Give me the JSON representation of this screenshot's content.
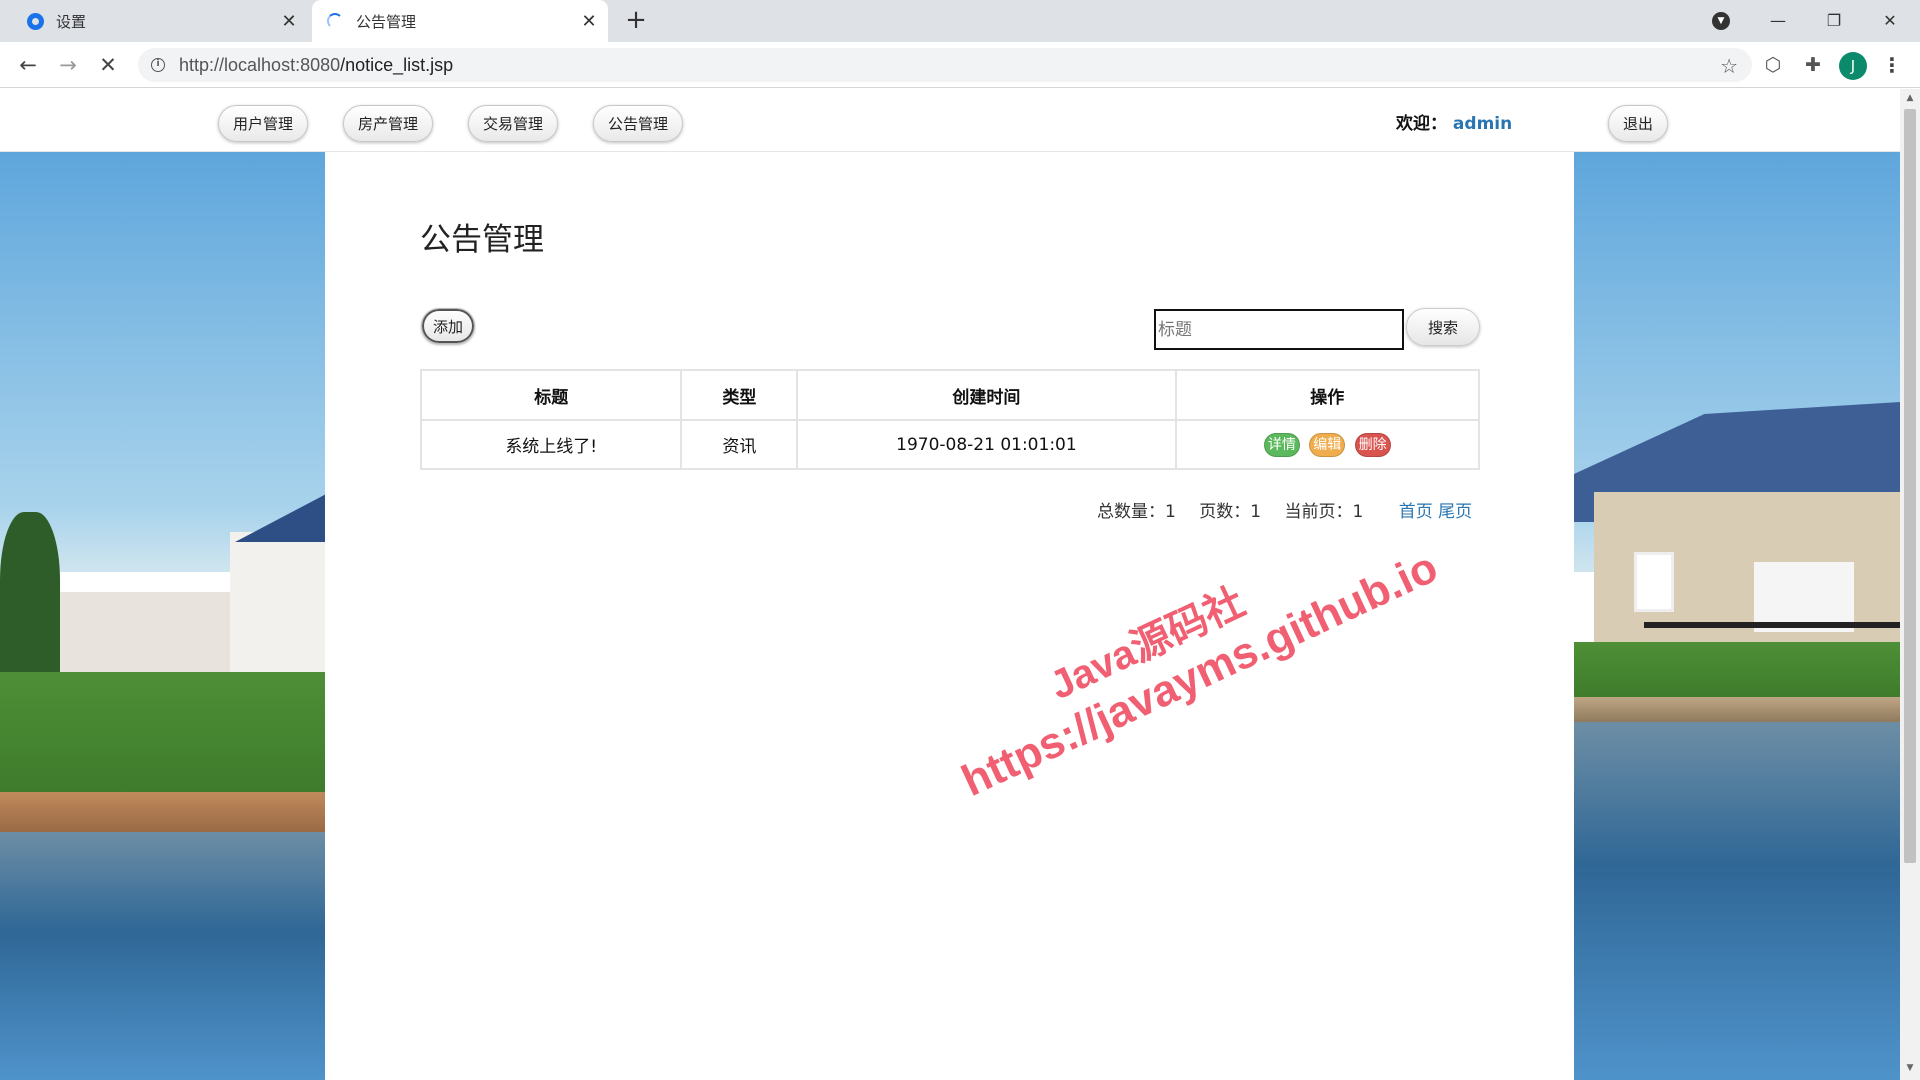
{
  "browser": {
    "tabs": [
      {
        "title": "设置",
        "icon": "gear-icon"
      },
      {
        "title": "公告管理",
        "icon": "loading-spinner-icon"
      }
    ],
    "url_host": "http://localhost:8080",
    "url_path": "/notice_list.jsp",
    "profile_initial": "J"
  },
  "nav": {
    "items": [
      "用户管理",
      "房产管理",
      "交易管理",
      "公告管理"
    ],
    "welcome_label": "欢迎：",
    "username": "admin",
    "logout_label": "退出"
  },
  "main": {
    "page_title": "公告管理",
    "add_label": "添加",
    "search_placeholder": "标题",
    "search_label": "搜索",
    "table": {
      "headers": [
        "标题",
        "类型",
        "创建时间",
        "操作"
      ],
      "rows": [
        {
          "title": "系统上线了!",
          "type": "资讯",
          "created": "1970-08-21 01:01:01"
        }
      ],
      "actions": {
        "detail": "详情",
        "edit": "编辑",
        "delete": "删除"
      }
    },
    "pager": {
      "total": "总数量：1",
      "pages": "页数：1",
      "current": "当前页：1",
      "first": "首页",
      "last": "尾页"
    }
  },
  "watermark": {
    "line1": "Java源码社",
    "line2": "https://javayms.github.io"
  },
  "colors": {
    "accent_link": "#2a76b2",
    "detail": "#5cb85c",
    "edit": "#f0ad4e",
    "delete": "#d9534f",
    "watermark": "#ef4f63"
  }
}
